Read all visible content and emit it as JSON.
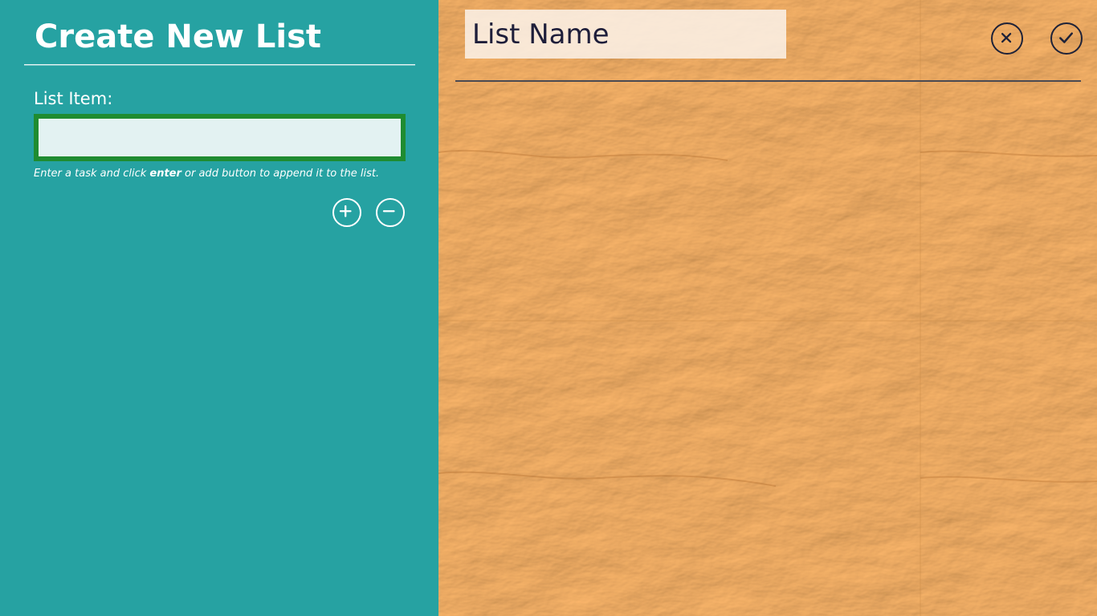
{
  "left": {
    "title": "Create New List",
    "field_label": "List Item:",
    "item_input_value": "",
    "hint": {
      "before": "Enter a task and click ",
      "bold": "enter",
      "after": " or add button to append it to the list."
    },
    "buttons": {
      "add_icon": "plus-icon",
      "remove_icon": "minus-icon"
    }
  },
  "right": {
    "name_placeholder": "List Name",
    "name_value": "",
    "buttons": {
      "cancel_icon": "close-icon",
      "confirm_icon": "checkmark-icon"
    }
  },
  "colors": {
    "left_background": "#26a2a2",
    "input_border": "#1f8c31",
    "paper_base": "#dd9a52",
    "dark_ink": "#1e2238"
  }
}
